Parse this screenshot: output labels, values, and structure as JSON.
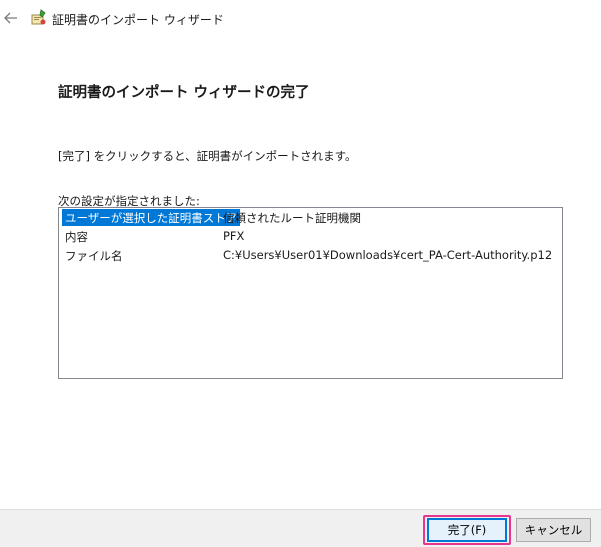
{
  "window": {
    "title": "証明書のインポート ウィザード"
  },
  "icons": {
    "back": "arrow-left-icon",
    "wizard": "certificate-wizard-icon"
  },
  "page": {
    "heading": "証明書のインポート ウィザードの完了",
    "intro": "[完了] をクリックすると、証明書がインポートされます。",
    "settings_label": "次の設定が指定されました:"
  },
  "settings": [
    {
      "key": "ユーザーが選択した証明書ストア",
      "value": "信頼されたルート証明機関",
      "selected": true
    },
    {
      "key": "内容",
      "value": "PFX",
      "selected": false
    },
    {
      "key": "ファイル名",
      "value": "C:¥Users¥User01¥Downloads¥cert_PA-Cert-Authority.p12",
      "selected": false
    }
  ],
  "buttons": {
    "finish": "完了(F)",
    "cancel": "キャンセル"
  },
  "colors": {
    "selection": "#0078d7",
    "highlight": "#e8368f",
    "footer_bg": "#f0f0f0"
  }
}
